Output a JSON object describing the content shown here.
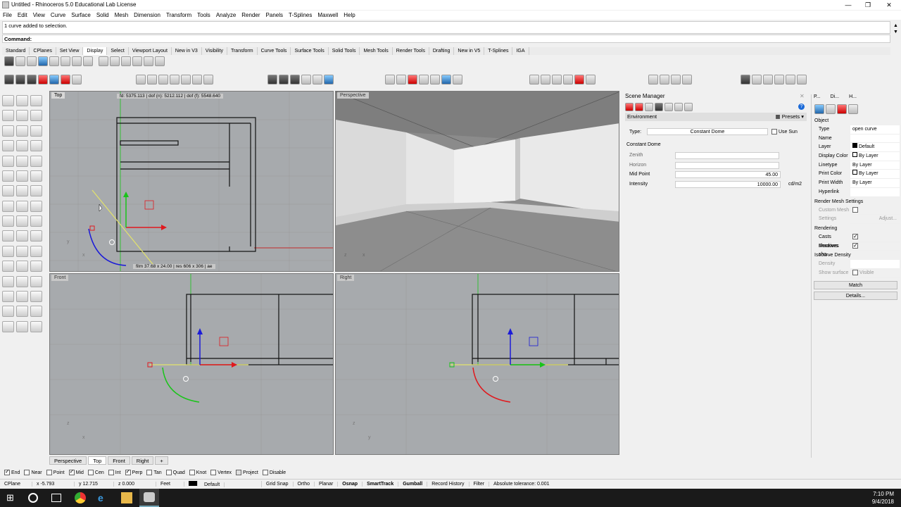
{
  "title": "Untitled - Rhinoceros 5.0 Educational Lab License",
  "window_buttons": [
    "—",
    "❐",
    "✕"
  ],
  "menu": [
    "File",
    "Edit",
    "View",
    "Curve",
    "Surface",
    "Solid",
    "Mesh",
    "Dimension",
    "Transform",
    "Tools",
    "Analyze",
    "Render",
    "Panels",
    "T-Splines",
    "Maxwell",
    "Help"
  ],
  "command_history": "1 curve added to selection.",
  "command_prompt": "Command:",
  "toolbar_tabs": [
    "Standard",
    "CPlanes",
    "Set View",
    "Display",
    "Select",
    "Viewport Layout",
    "New in V3",
    "Visibility",
    "Transform",
    "Curve Tools",
    "Surface Tools",
    "Solid Tools",
    "Mesh Tools",
    "Render Tools",
    "Drafting",
    "New in V5",
    "T-Splines",
    "IGA"
  ],
  "active_toolbar_tab": "Display",
  "viewports": {
    "top": {
      "label": "Top",
      "overlay_top": "fd: 5375.113  |  dof (n): 5212.112  |  dof (f): 5548.640",
      "overlay_bottom": "film 37.68 x 24.00  |  res 606 x 306  |  ae"
    },
    "perspective": {
      "label": "Perspective"
    },
    "front": {
      "label": "Front"
    },
    "right": {
      "label": "Right"
    }
  },
  "viewport_tabs": [
    "Perspective",
    "Top",
    "Front",
    "Right",
    "+"
  ],
  "active_viewport_tab": "Top",
  "scene_manager": {
    "title": "Scene Manager",
    "section": "Environment",
    "presets": "Presets",
    "type_label": "Type:",
    "type_value": "Constant Dome",
    "use_sun": "Use Sun",
    "group": "Constant Dome",
    "zenith": "Zenith",
    "horizon": "Horizon",
    "mid_point_label": "Mid Point",
    "mid_point_value": "45.00",
    "intensity_label": "Intensity",
    "intensity_value": "10000.00",
    "intensity_unit": "cd/m2"
  },
  "properties": {
    "tabs": [
      "P...",
      "Di...",
      "H..."
    ],
    "object_header": "Object",
    "rows": [
      {
        "k": "Type",
        "v": "open curve"
      },
      {
        "k": "Name",
        "v": ""
      },
      {
        "k": "Layer",
        "v": "Default"
      },
      {
        "k": "Display Color",
        "v": "By Layer"
      },
      {
        "k": "Linetype",
        "v": "By Layer"
      },
      {
        "k": "Print Color",
        "v": "By Layer"
      },
      {
        "k": "Print Width",
        "v": "By Layer"
      },
      {
        "k": "Hyperlink",
        "v": ""
      }
    ],
    "render_mesh_header": "Render Mesh Settings",
    "custom_mesh": "Custom Mesh",
    "settings": "Settings",
    "adjust": "Adjust...",
    "rendering_header": "Rendering",
    "casts_shadows": "Casts shadows",
    "receives_shadows": "Receives sha...",
    "isocurve_header": "Isocurve Density",
    "density": "Density",
    "show_surface": "Show surface",
    "visible": "Visible",
    "match": "Match",
    "details": "Details..."
  },
  "osnaps": [
    {
      "label": "End",
      "on": true
    },
    {
      "label": "Near",
      "on": false
    },
    {
      "label": "Point",
      "on": false
    },
    {
      "label": "Mid",
      "on": true
    },
    {
      "label": "Cen",
      "on": false
    },
    {
      "label": "Int",
      "on": false
    },
    {
      "label": "Perp",
      "on": true
    },
    {
      "label": "Tan",
      "on": false
    },
    {
      "label": "Quad",
      "on": false
    },
    {
      "label": "Knot",
      "on": false
    },
    {
      "label": "Vertex",
      "on": false
    },
    {
      "label": "Project",
      "on": false
    },
    {
      "label": "Disable",
      "on": false
    }
  ],
  "status": {
    "cplane": "CPlane",
    "x": "x -5.793",
    "y": "y 12.715",
    "z": "z 0.000",
    "units": "Feet",
    "layer": "Default",
    "items": [
      "Grid Snap",
      "Ortho",
      "Planar",
      "Osnap",
      "SmartTrack",
      "Gumball",
      "Record History",
      "Filter"
    ],
    "bold_items": [
      "Osnap",
      "SmartTrack",
      "Gumball"
    ],
    "tolerance": "Absolute tolerance: 0.001"
  },
  "clock": {
    "time": "7:10 PM",
    "date": "9/4/2018"
  },
  "colors": {
    "viewport": "#a7aaad",
    "accent_red": "#e0191e",
    "accent_green": "#19c419",
    "accent_blue": "#1b1bd8"
  }
}
